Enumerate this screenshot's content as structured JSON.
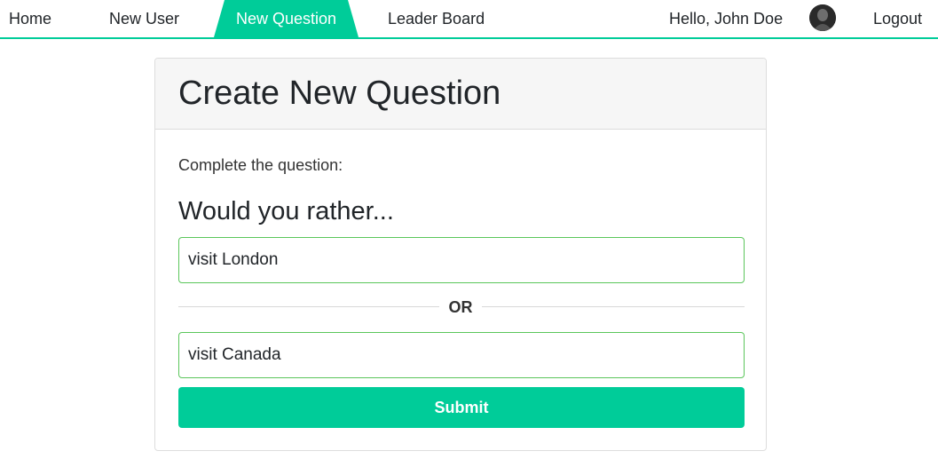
{
  "nav": {
    "home": "Home",
    "new_user": "New User",
    "new_question": "New Question",
    "leader_board": "Leader Board",
    "greeting": "Hello, John Doe",
    "logout": "Logout",
    "active_color": "#00cc99"
  },
  "card": {
    "title": "Create New Question",
    "prompt": "Complete the question:",
    "would_you_rather": "Would you rather...",
    "option_one_value": "visit London",
    "divider_text": "OR",
    "option_two_value": "visit Canada",
    "submit_label": "Submit"
  }
}
